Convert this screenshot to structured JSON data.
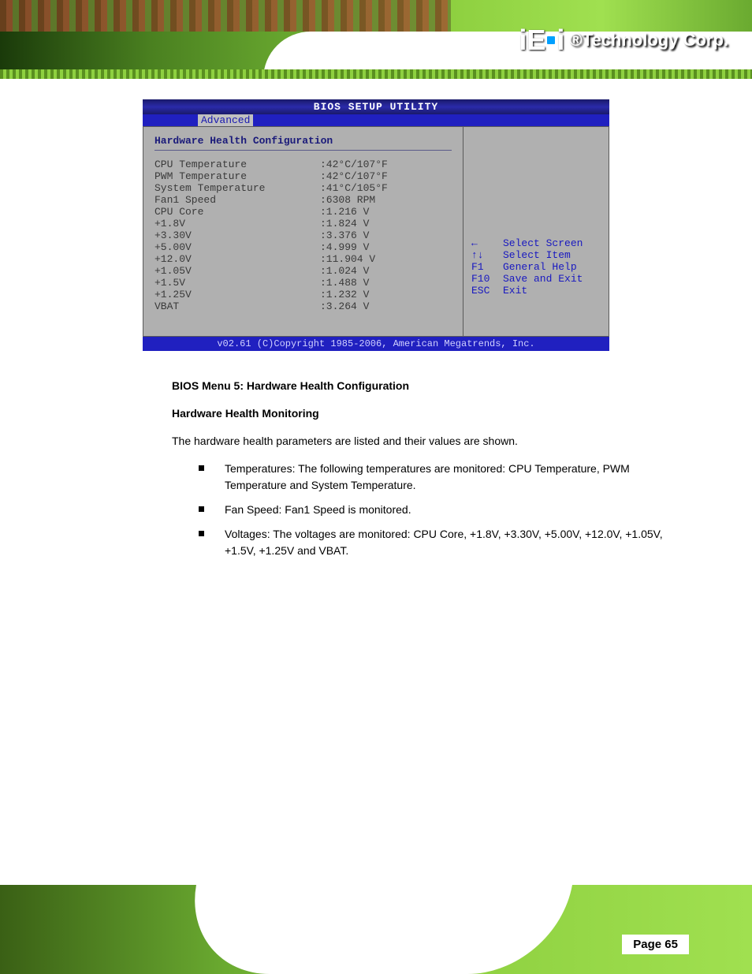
{
  "header": {
    "logo": "iEi",
    "tagline": "®Technology Corp."
  },
  "bios": {
    "title": "BIOS SETUP UTILITY",
    "active_tab": "Advanced",
    "section": "Hardware Health Configuration",
    "rows": [
      {
        "label": "CPU Temperature",
        "value": ":42°C/107°F"
      },
      {
        "label": "PWM Temperature",
        "value": ":42°C/107°F"
      },
      {
        "label": "System Temperature",
        "value": ":41°C/105°F"
      },
      {
        "label": "",
        "value": ""
      },
      {
        "label": "Fan1 Speed",
        "value": ":6308 RPM"
      },
      {
        "label": "",
        "value": ""
      },
      {
        "label": "CPU Core",
        "value": ":1.216 V"
      },
      {
        "label": "+1.8V",
        "value": ":1.824 V"
      },
      {
        "label": "+3.30V",
        "value": ":3.376 V"
      },
      {
        "label": "+5.00V",
        "value": ":4.999 V"
      },
      {
        "label": "+12.0V",
        "value": ":11.904 V"
      },
      {
        "label": "+1.05V",
        "value": ":1.024 V"
      },
      {
        "label": "+1.5V",
        "value": ":1.488 V"
      },
      {
        "label": "+1.25V",
        "value": ":1.232 V"
      },
      {
        "label": "VBAT",
        "value": ":3.264 V"
      }
    ],
    "help": [
      {
        "key": "←",
        "action": "Select Screen"
      },
      {
        "key": "↑↓",
        "action": "Select Item"
      },
      {
        "key": "F1",
        "action": "General Help"
      },
      {
        "key": "F10",
        "action": "Save and Exit"
      },
      {
        "key": "ESC",
        "action": "Exit"
      }
    ],
    "footer": "v02.61 (C)Copyright 1985-2006, American Megatrends, Inc."
  },
  "doc": {
    "caption": "BIOS Menu 5: Hardware Health Configuration",
    "subhead": "Hardware Health Monitoring",
    "para1": "The hardware health parameters are listed and their values are shown.",
    "bullet1": "Temperatures: The following temperatures are monitored: CPU Temperature, PWM Temperature and System Temperature.",
    "bullet2": "Fan Speed: Fan1 Speed is monitored.",
    "bullet3": "Voltages: The voltages are monitored: CPU Core, +1.8V, +3.30V, +5.00V, +12.0V, +1.05V, +1.5V, +1.25V and VBAT."
  },
  "page_number": "Page 65"
}
